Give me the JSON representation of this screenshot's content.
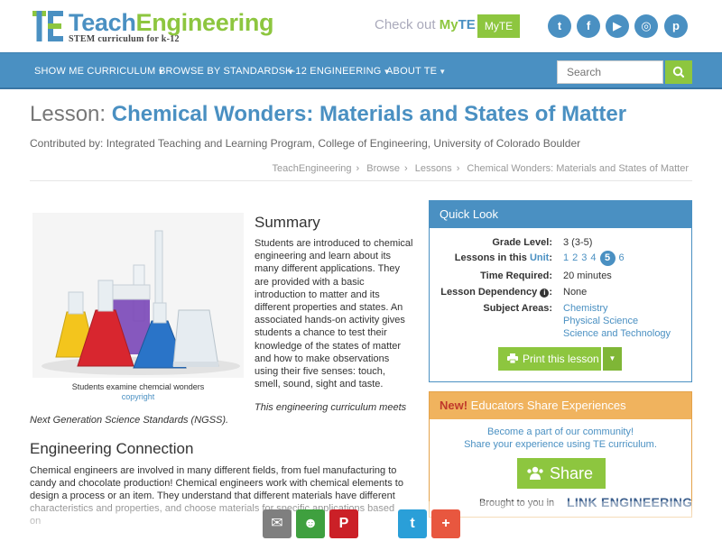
{
  "header": {
    "logo_part1": "Teach",
    "logo_part2": "Engineering",
    "tagline": "STEM curriculum for k-12",
    "checkout_prefix": "Check out ",
    "checkout_my": "My",
    "checkout_te": "TE",
    "myte_button": "MyTE",
    "social": [
      {
        "icon": "twitter-icon",
        "glyph": "t"
      },
      {
        "icon": "facebook-icon",
        "glyph": "f"
      },
      {
        "icon": "youtube-icon",
        "glyph": "▶"
      },
      {
        "icon": "instagram-icon",
        "glyph": "◎"
      },
      {
        "icon": "pinterest-icon",
        "glyph": "p"
      }
    ]
  },
  "nav": {
    "items": [
      "SHOW ME CURRICULUM",
      "BROWSE BY STANDARDS",
      "K-12 ENGINEERING",
      "ABOUT TE"
    ],
    "search_placeholder": "Search"
  },
  "lesson": {
    "prefix": "Lesson: ",
    "title": "Chemical Wonders: Materials and States of Matter",
    "contributed": "Contributed by: Integrated Teaching and Learning Program, College of Engineering, University of Colorado Boulder"
  },
  "breadcrumb": [
    "TeachEngineering",
    "Browse",
    "Lessons",
    "Chemical Wonders: Materials and States of Matter"
  ],
  "image": {
    "caption": "Students examine chemcial wonders",
    "credit": "copyright"
  },
  "summary": {
    "heading": "Summary",
    "text": "Students are introduced to chemical engineering and learn about its many different applications. They are provided with a basic introduction to matter and its different properties and states. An associated hands-on activity gives students a chance to test their knowledge of the states of matter and how to make observations using their five senses: touch, smell, sound, sight and taste.",
    "ngss_part1": "This engineering curriculum meets",
    "ngss_part2": "Next Generation Science Standards (NGSS)."
  },
  "engineering": {
    "heading": "Engineering Connection",
    "text": "Chemical engineers are involved in many different fields, from fuel manufacturing to candy and chocolate production! Chemical engineers work with chemical elements to design a process or an item. They understand that different materials have different characteristics and properties, and choose materials for specific applications based on"
  },
  "quick_look": {
    "heading": "Quick Look",
    "grade_label": "Grade Level:",
    "grade_value": "3 (3-5)",
    "lessons_label_prefix": "Lessons in this ",
    "lessons_label_link": "Unit",
    "lessons_label_suffix": ":",
    "units": [
      "1",
      "2",
      "3",
      "4"
    ],
    "current_unit": "5",
    "units_after": [
      "6"
    ],
    "time_label": "Time Required:",
    "time_value": "20 minutes",
    "dependency_label": "Lesson Dependency",
    "dependency_value": "None",
    "subject_label": "Subject Areas:",
    "subjects": [
      "Chemistry",
      "Physical Science",
      "Science and Technology"
    ],
    "print_button": "Print this lesson"
  },
  "educators": {
    "new_label": "New!",
    "heading": " Educators Share Experiences",
    "line1": "Become a part of our community!",
    "line2": "Share your experience using TE curriculum.",
    "share_button": "Share",
    "brought": "Brought to you in",
    "partner_logo": "LINK ENGINEERING"
  },
  "share_bar": [
    {
      "name": "email-share-button",
      "icon": "email-icon",
      "glyph": "✉",
      "color": "#7f7f7f"
    },
    {
      "name": "community-share-button",
      "icon": "community-icon",
      "glyph": "☻",
      "color": "#3fa03f"
    },
    {
      "name": "pinterest-share-button",
      "icon": "pinterest-icon",
      "glyph": "P",
      "color": "#cb2027"
    },
    {
      "name": "twitter-share-button",
      "icon": "twitter-icon",
      "glyph": "t",
      "color": "#2a9fd8"
    },
    {
      "name": "more-share-button",
      "icon": "plus-icon",
      "glyph": "+",
      "color": "#e8573f"
    }
  ],
  "colors": {
    "primary_blue": "#4a90c2",
    "accent_green": "#8dc63f",
    "orange": "#f0b35e"
  }
}
